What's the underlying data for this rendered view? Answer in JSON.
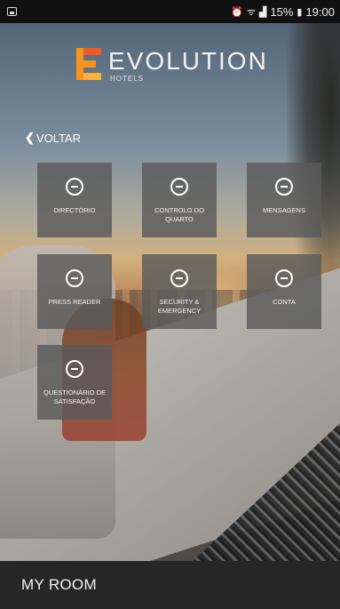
{
  "status_bar": {
    "battery": "15%",
    "time": "19:00"
  },
  "brand": {
    "name": "EVOLUTION",
    "subtitle": "HOTELS",
    "accent_color": "#f7941d"
  },
  "back": {
    "label": "VOLTAR"
  },
  "tiles": [
    {
      "label": "DIRECTÓRIO",
      "icon": "minus-circle-icon"
    },
    {
      "label": "CONTROLO DO QUARTO",
      "icon": "minus-circle-icon"
    },
    {
      "label": "MENSAGENS",
      "icon": "minus-circle-icon"
    },
    {
      "label": "PRESS READER",
      "icon": "minus-circle-icon"
    },
    {
      "label": "SECURITY & EMERGENCY",
      "icon": "minus-circle-icon"
    },
    {
      "label": "CONTA",
      "icon": "minus-circle-icon"
    },
    {
      "label": "QUESTIONÁRIO DE SATISFAÇÃO",
      "icon": "minus-circle-icon"
    }
  ],
  "bottom_bar": {
    "title": "MY ROOM"
  }
}
